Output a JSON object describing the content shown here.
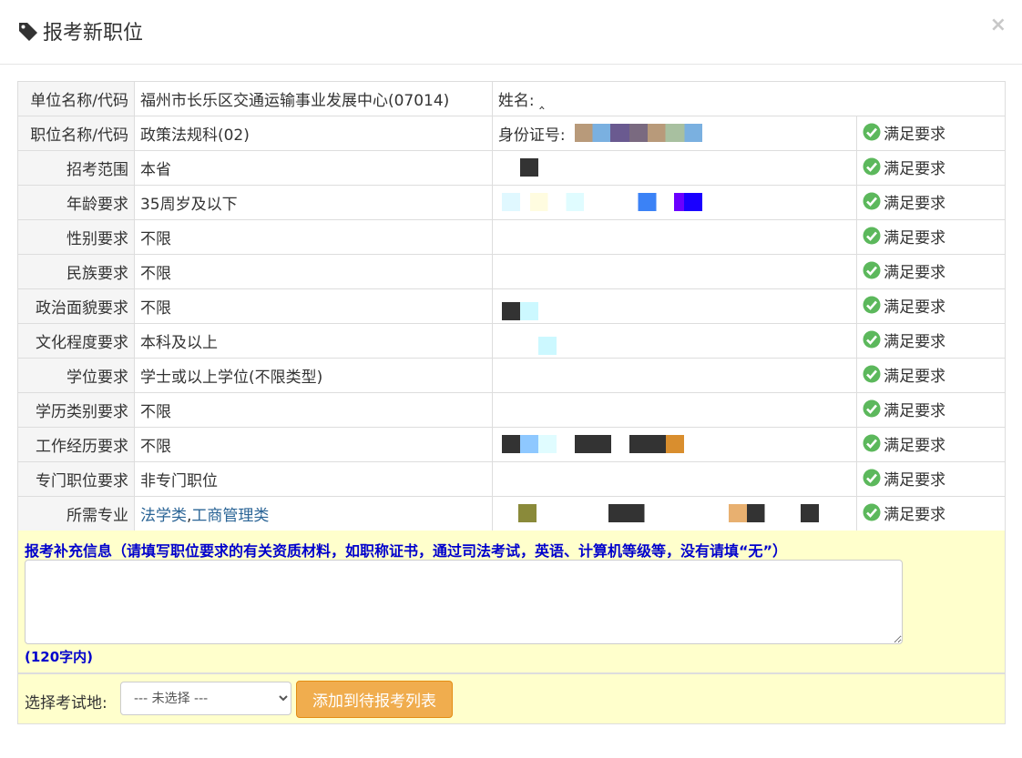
{
  "dialog": {
    "title": "报考新职位",
    "close_label": "×"
  },
  "table": {
    "unit": {
      "label": "单位名称/代码",
      "value": "福州市长乐区交通运输事业发展中心(07014)",
      "name_label": "姓名: ",
      "name_value": "‸"
    },
    "rows": [
      {
        "label": "职位名称/代码",
        "value": "政策法规科(02)",
        "user_text": "身份证号:",
        "status": "满足要求"
      },
      {
        "label": "招考范围",
        "value": "本省",
        "user_text": "",
        "status": "满足要求"
      },
      {
        "label": "年龄要求",
        "value": "35周岁及以下",
        "user_text": "",
        "status": "满足要求"
      },
      {
        "label": "性别要求",
        "value": "不限",
        "user_text": "",
        "status": "满足要求"
      },
      {
        "label": "民族要求",
        "value": "不限",
        "user_text": "",
        "status": "满足要求"
      },
      {
        "label": "政治面貌要求",
        "value": "不限",
        "user_text": "",
        "status": "满足要求"
      },
      {
        "label": "文化程度要求",
        "value": "本科及以上",
        "user_text": "",
        "status": "满足要求"
      },
      {
        "label": "学位要求",
        "value": "学士或以上学位(不限类型)",
        "user_text": "",
        "status": "满足要求"
      },
      {
        "label": "学历类别要求",
        "value": "不限",
        "user_text": "",
        "status": "满足要求"
      },
      {
        "label": "工作经历要求",
        "value": "不限",
        "user_text": "",
        "status": "满足要求"
      },
      {
        "label": "专门职位要求",
        "value": "非专门职位",
        "user_text": "",
        "status": "满足要求"
      }
    ],
    "major": {
      "label": "所需专业",
      "link1": "法学类",
      "separator": ",",
      "link2": "工商管理类",
      "status": "满足要求"
    }
  },
  "supplement": {
    "title": "报考补充信息（请填写职位要求的有关资质材料，如职称证书，通过司法考试，英语、计算机等级等，没有请填“无”）",
    "value": "",
    "limit": "(120字内)"
  },
  "exam": {
    "label": "选择考试地:",
    "selected": "--- 未选择 ---",
    "add_button": "添加到待报考列表"
  },
  "colors": {
    "status_ok": "#5cb85c",
    "link": "#2a6496",
    "supp_bg": "#ffffcc",
    "supp_text": "#0000cc",
    "button": "#f0ad4e"
  }
}
